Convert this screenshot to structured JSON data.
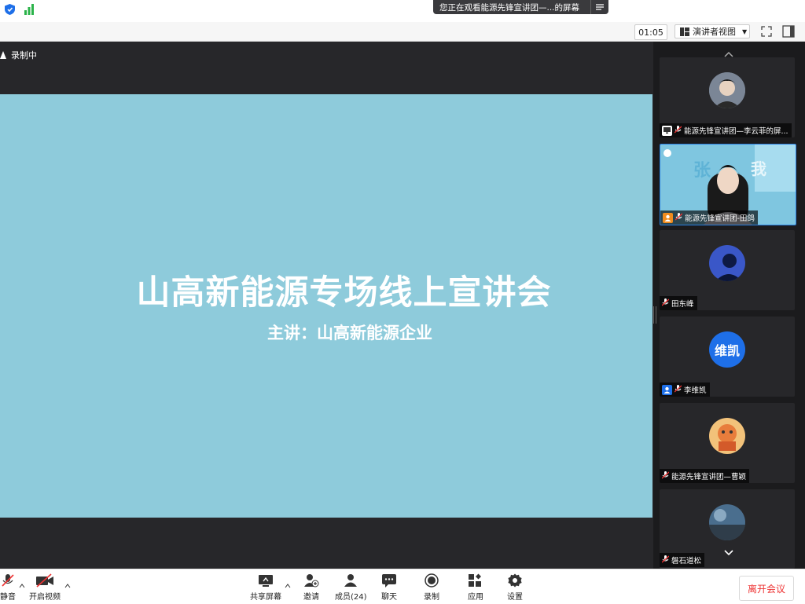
{
  "banner": {
    "text": "您正在观看能源先锋宣讲团—...的屏幕",
    "menu_icon": "menu-lines-icon"
  },
  "toolbar": {
    "timer": "01:05",
    "view_label": "演讲者视图",
    "icons": [
      "shield-icon",
      "signal-icon",
      "fullscreen-icon",
      "sidebar-toggle-icon"
    ]
  },
  "stage": {
    "recording_label": "录制中",
    "slide": {
      "title": "山高新能源专场线上宣讲会",
      "subtitle": "主讲：山高新能源企业",
      "background": "#8ecbdb"
    }
  },
  "gallery": {
    "tiles": [
      {
        "name": "能源先锋宣讲团—李云菲的屏...",
        "kind": "photo",
        "badge": "screen-share-icon"
      },
      {
        "name": "能源先锋宣讲团-田鸽",
        "kind": "video",
        "badge": "user-icon"
      },
      {
        "name": "田东峰",
        "kind": "photo",
        "badge": ""
      },
      {
        "name": "李维凯",
        "kind": "initials",
        "initials": "维凯",
        "badge": "user-icon"
      },
      {
        "name": "能源先锋宣讲团—曹颖",
        "kind": "photo",
        "badge": ""
      },
      {
        "name": "磐石道松",
        "kind": "photo",
        "badge": ""
      }
    ]
  },
  "bottombar": {
    "mute": "静音",
    "video": "开启视频",
    "share": "共享屏幕",
    "invite": "邀请",
    "members": "成员(24)",
    "chat": "聊天",
    "record": "录制",
    "apps": "应用",
    "settings": "设置",
    "leave": "离开会议"
  },
  "colors": {
    "accent": "#1e6fe8",
    "leave": "#e33333",
    "stage": "#27272a"
  }
}
